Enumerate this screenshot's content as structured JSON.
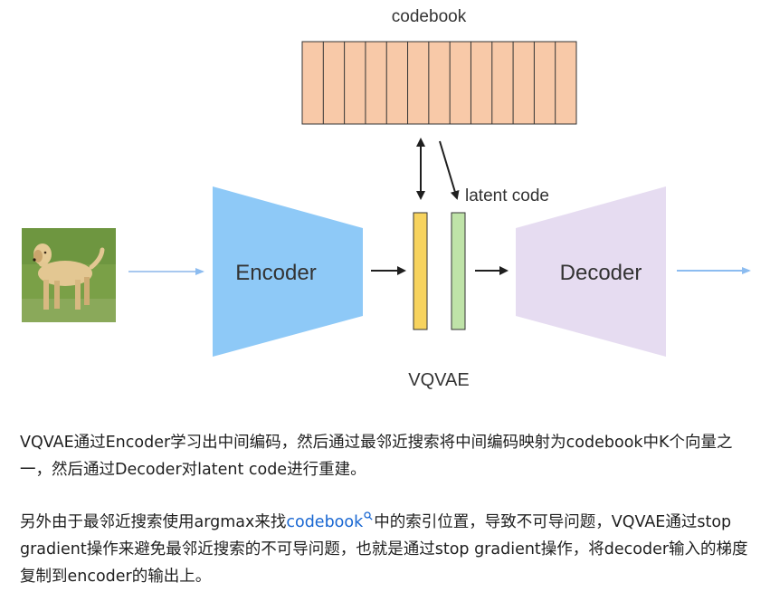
{
  "diagram": {
    "codebook_label": "codebook",
    "encoder_label": "Encoder",
    "decoder_label": "Decoder",
    "latent_label": "latent code",
    "model_label": "VQVAE",
    "input_image_icon": "dog-photo",
    "colors": {
      "codebook_fill": "#f8c9a8",
      "encoder_fill": "#8ec9f7",
      "decoder_fill": "#e6dcf1",
      "latent_yellow": "#f7d35e",
      "latent_green": "#bfe3a8",
      "input_arrow": "#a8c8ef",
      "output_arrow": "#8cbcf0",
      "black_arrow": "#1f1f1f"
    }
  },
  "text": {
    "paragraph1": "VQVAE通过Encoder学习出中间编码，然后通过最邻近搜索将中间编码映射为codebook中K个向量之一，然后通过Decoder对latent code进行重建。",
    "paragraph2_before_link": "另外由于最邻近搜索使用argmax来找",
    "paragraph2_link": "codebook",
    "paragraph2_after_link": "中的索引位置，导致不可导问题，VQVAE通过stop gradient操作来避免最邻近搜索的不可导问题，也就是通过stop gradient操作，将decoder输入的梯度复制到encoder的输出上。",
    "link_icon": "search-icon"
  }
}
